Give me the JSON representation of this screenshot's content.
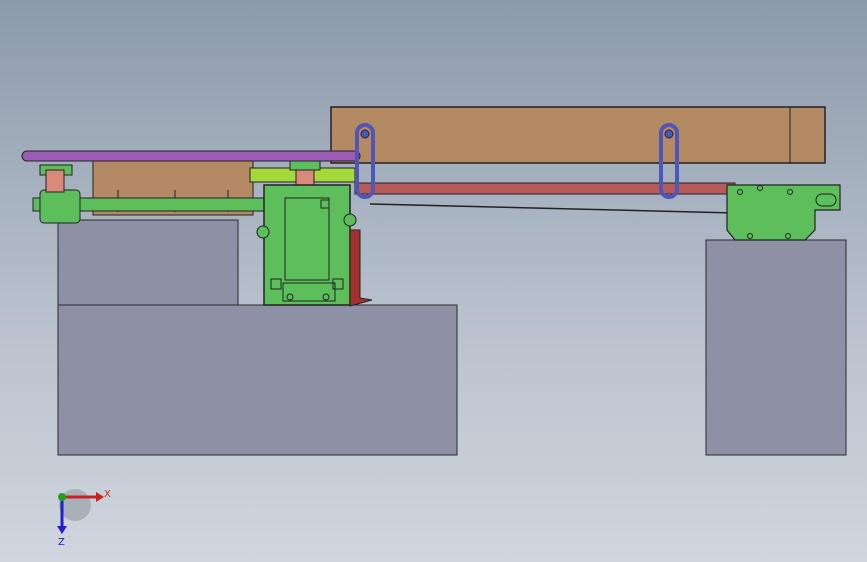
{
  "viewport": {
    "background_top": "#8d9aab",
    "background_bottom": "#d0d6de"
  },
  "colors": {
    "machine_base": "#8e90a6",
    "wood_board": "#b48a65",
    "green_part": "#5cbf5c",
    "yellow_green_part": "#a4d83c",
    "purple_belt": "#9b5bb6",
    "red_rail": "#b85a5a",
    "blue_link": "#4f56b8",
    "salmon_shaft": "#d98a7a",
    "dark_red_motor": "#a33030"
  },
  "triad": {
    "x_label": "X",
    "z_label": "Z",
    "x_color": "#cc2020",
    "y_color": "#20a020",
    "z_color": "#2020cc"
  }
}
